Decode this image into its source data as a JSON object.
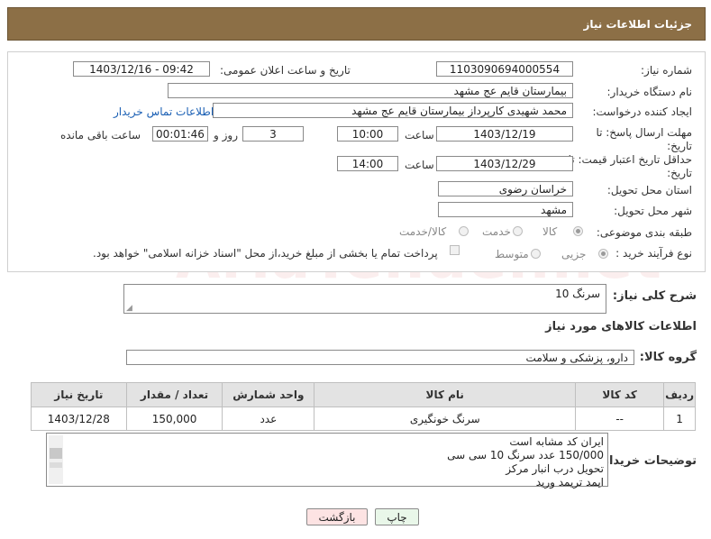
{
  "header": {
    "title": "جزئیات اطلاعات نیاز"
  },
  "fields": {
    "need_number_label": "شماره نیاز:",
    "need_number": "1103090694000554",
    "announce_label": "تاریخ و ساعت اعلان عمومی:",
    "announce_value": "1403/12/16 - 09:42",
    "buyer_org_label": "نام دستگاه خریدار:",
    "buyer_org": "بیمارستان قایم  عج  مشهد",
    "creator_label": "ایجاد کننده درخواست:",
    "creator": "محمد شهیدی کارپرداز بیمارستان قایم  عج  مشهد",
    "contact_link": "اطلاعات تماس خریدار",
    "deadline_label_1": "مهلت ارسال پاسخ: تا",
    "deadline_label_2": "تاریخ:",
    "deadline_date": "1403/12/19",
    "time_label": "ساعت",
    "deadline_time": "10:00",
    "days_value": "3",
    "days_label": "روز و",
    "remaining_time": "00:01:46",
    "remaining_label": "ساعت باقی مانده",
    "validity_label_1": "حداقل تاریخ اعتبار قیمت: تا",
    "validity_label_2": "تاریخ:",
    "validity_date": "1403/12/29",
    "validity_time": "14:00",
    "province_label": "استان محل تحویل:",
    "province": "خراسان رضوی",
    "city_label": "شهر محل تحویل:",
    "city": "مشهد",
    "category_label": "طبقه بندی موضوعی:",
    "category_options": [
      "کالا",
      "خدمت",
      "کالا/خدمت"
    ],
    "process_label": "نوع فرآیند خرید :",
    "process_options": [
      "جزیی",
      "متوسط"
    ],
    "payment_note": "پرداخت تمام یا بخشی از مبلغ خرید،از محل \"اسناد خزانه اسلامی\" خواهد بود."
  },
  "summary": {
    "label": "شرح کلی نیاز:",
    "value": "سرنگ 10"
  },
  "goods_section": {
    "title": "اطلاعات کالاهای مورد نیاز",
    "group_label": "گروه کالا:",
    "group_value": "دارو، پزشکی و سلامت"
  },
  "table": {
    "headers": [
      "ردیف",
      "کد کالا",
      "نام کالا",
      "واحد شمارش",
      "تعداد / مقدار",
      "تاریخ نیاز"
    ],
    "rows": [
      [
        "1",
        "--",
        "سرنگ خونگیری",
        "عدد",
        "150,000",
        "1403/12/28"
      ]
    ]
  },
  "buyer_notes": {
    "label": "توضیحات خریدار:",
    "lines": [
      "ایران کد مشابه  است",
      "150/000 عدد سرنگ 10 سی سی",
      "تحویل درب انبار مرکز",
      "ایمد تریمد ورید"
    ]
  },
  "buttons": {
    "print": "چاپ",
    "back": "بازگشت"
  },
  "colors": {
    "header_bg": "#8c6f46",
    "back_button_bg": "#fde3e3",
    "print_button_bg": "#e9f7e9"
  }
}
